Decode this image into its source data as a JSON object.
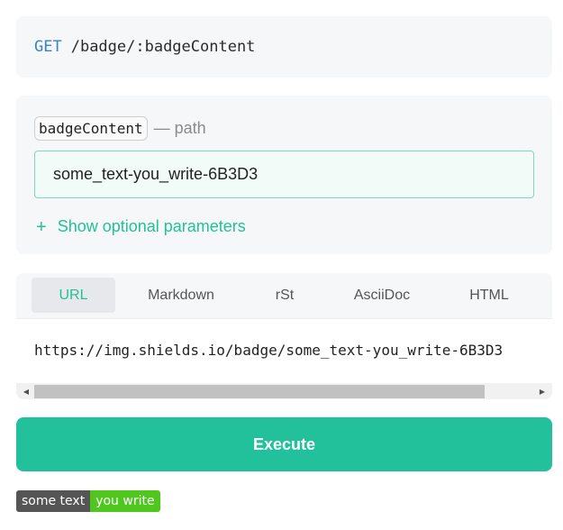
{
  "endpoint": {
    "method": "GET",
    "path": "/badge/:badgeContent"
  },
  "param": {
    "name": "badgeContent",
    "kind": "— path",
    "value": "some_text-you_write-6B3D3"
  },
  "optional": {
    "plus": "+",
    "label": "Show optional parameters"
  },
  "tabs": [
    {
      "label": "URL"
    },
    {
      "label": "Markdown"
    },
    {
      "label": "rSt"
    },
    {
      "label": "AsciiDoc"
    },
    {
      "label": "HTML"
    }
  ],
  "active_tab": "URL",
  "snippet": {
    "code": "https://img.shields.io/badge/some_text-you_write-6B3D3"
  },
  "execute": {
    "label": "Execute"
  },
  "badge": {
    "left_text": "some text",
    "right_text": "you write",
    "right_color": "#4fc71f"
  },
  "colors": {
    "accent": "#22c19c",
    "method": "#3b82c4"
  }
}
